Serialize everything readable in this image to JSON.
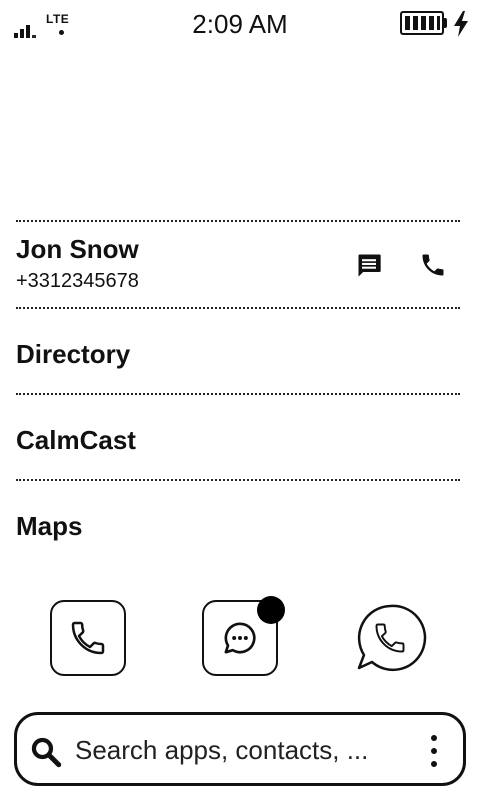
{
  "status_bar": {
    "network_type": "LTE",
    "time": "2:09 AM",
    "signal_icon": "cellular-signal-icon",
    "battery_icon": "battery-full-icon",
    "charging_icon": "lightning-bolt-icon"
  },
  "contact": {
    "name": "Jon Snow",
    "phone": "+3312345678",
    "message_icon": "message-icon",
    "call_icon": "phone-icon"
  },
  "list_items": [
    {
      "label": "Directory"
    },
    {
      "label": "CalmCast"
    },
    {
      "label": "Maps"
    }
  ],
  "dock": {
    "phone_icon": "phone-app-icon",
    "messages_icon": "messages-app-icon",
    "messages_has_badge": true,
    "whatsapp_icon": "whatsapp-icon"
  },
  "search": {
    "placeholder": "Search apps, contacts, ...",
    "search_icon": "search-icon",
    "more_icon": "more-vertical-icon"
  },
  "colors": {
    "background": "#ffffff",
    "foreground": "#111111"
  }
}
